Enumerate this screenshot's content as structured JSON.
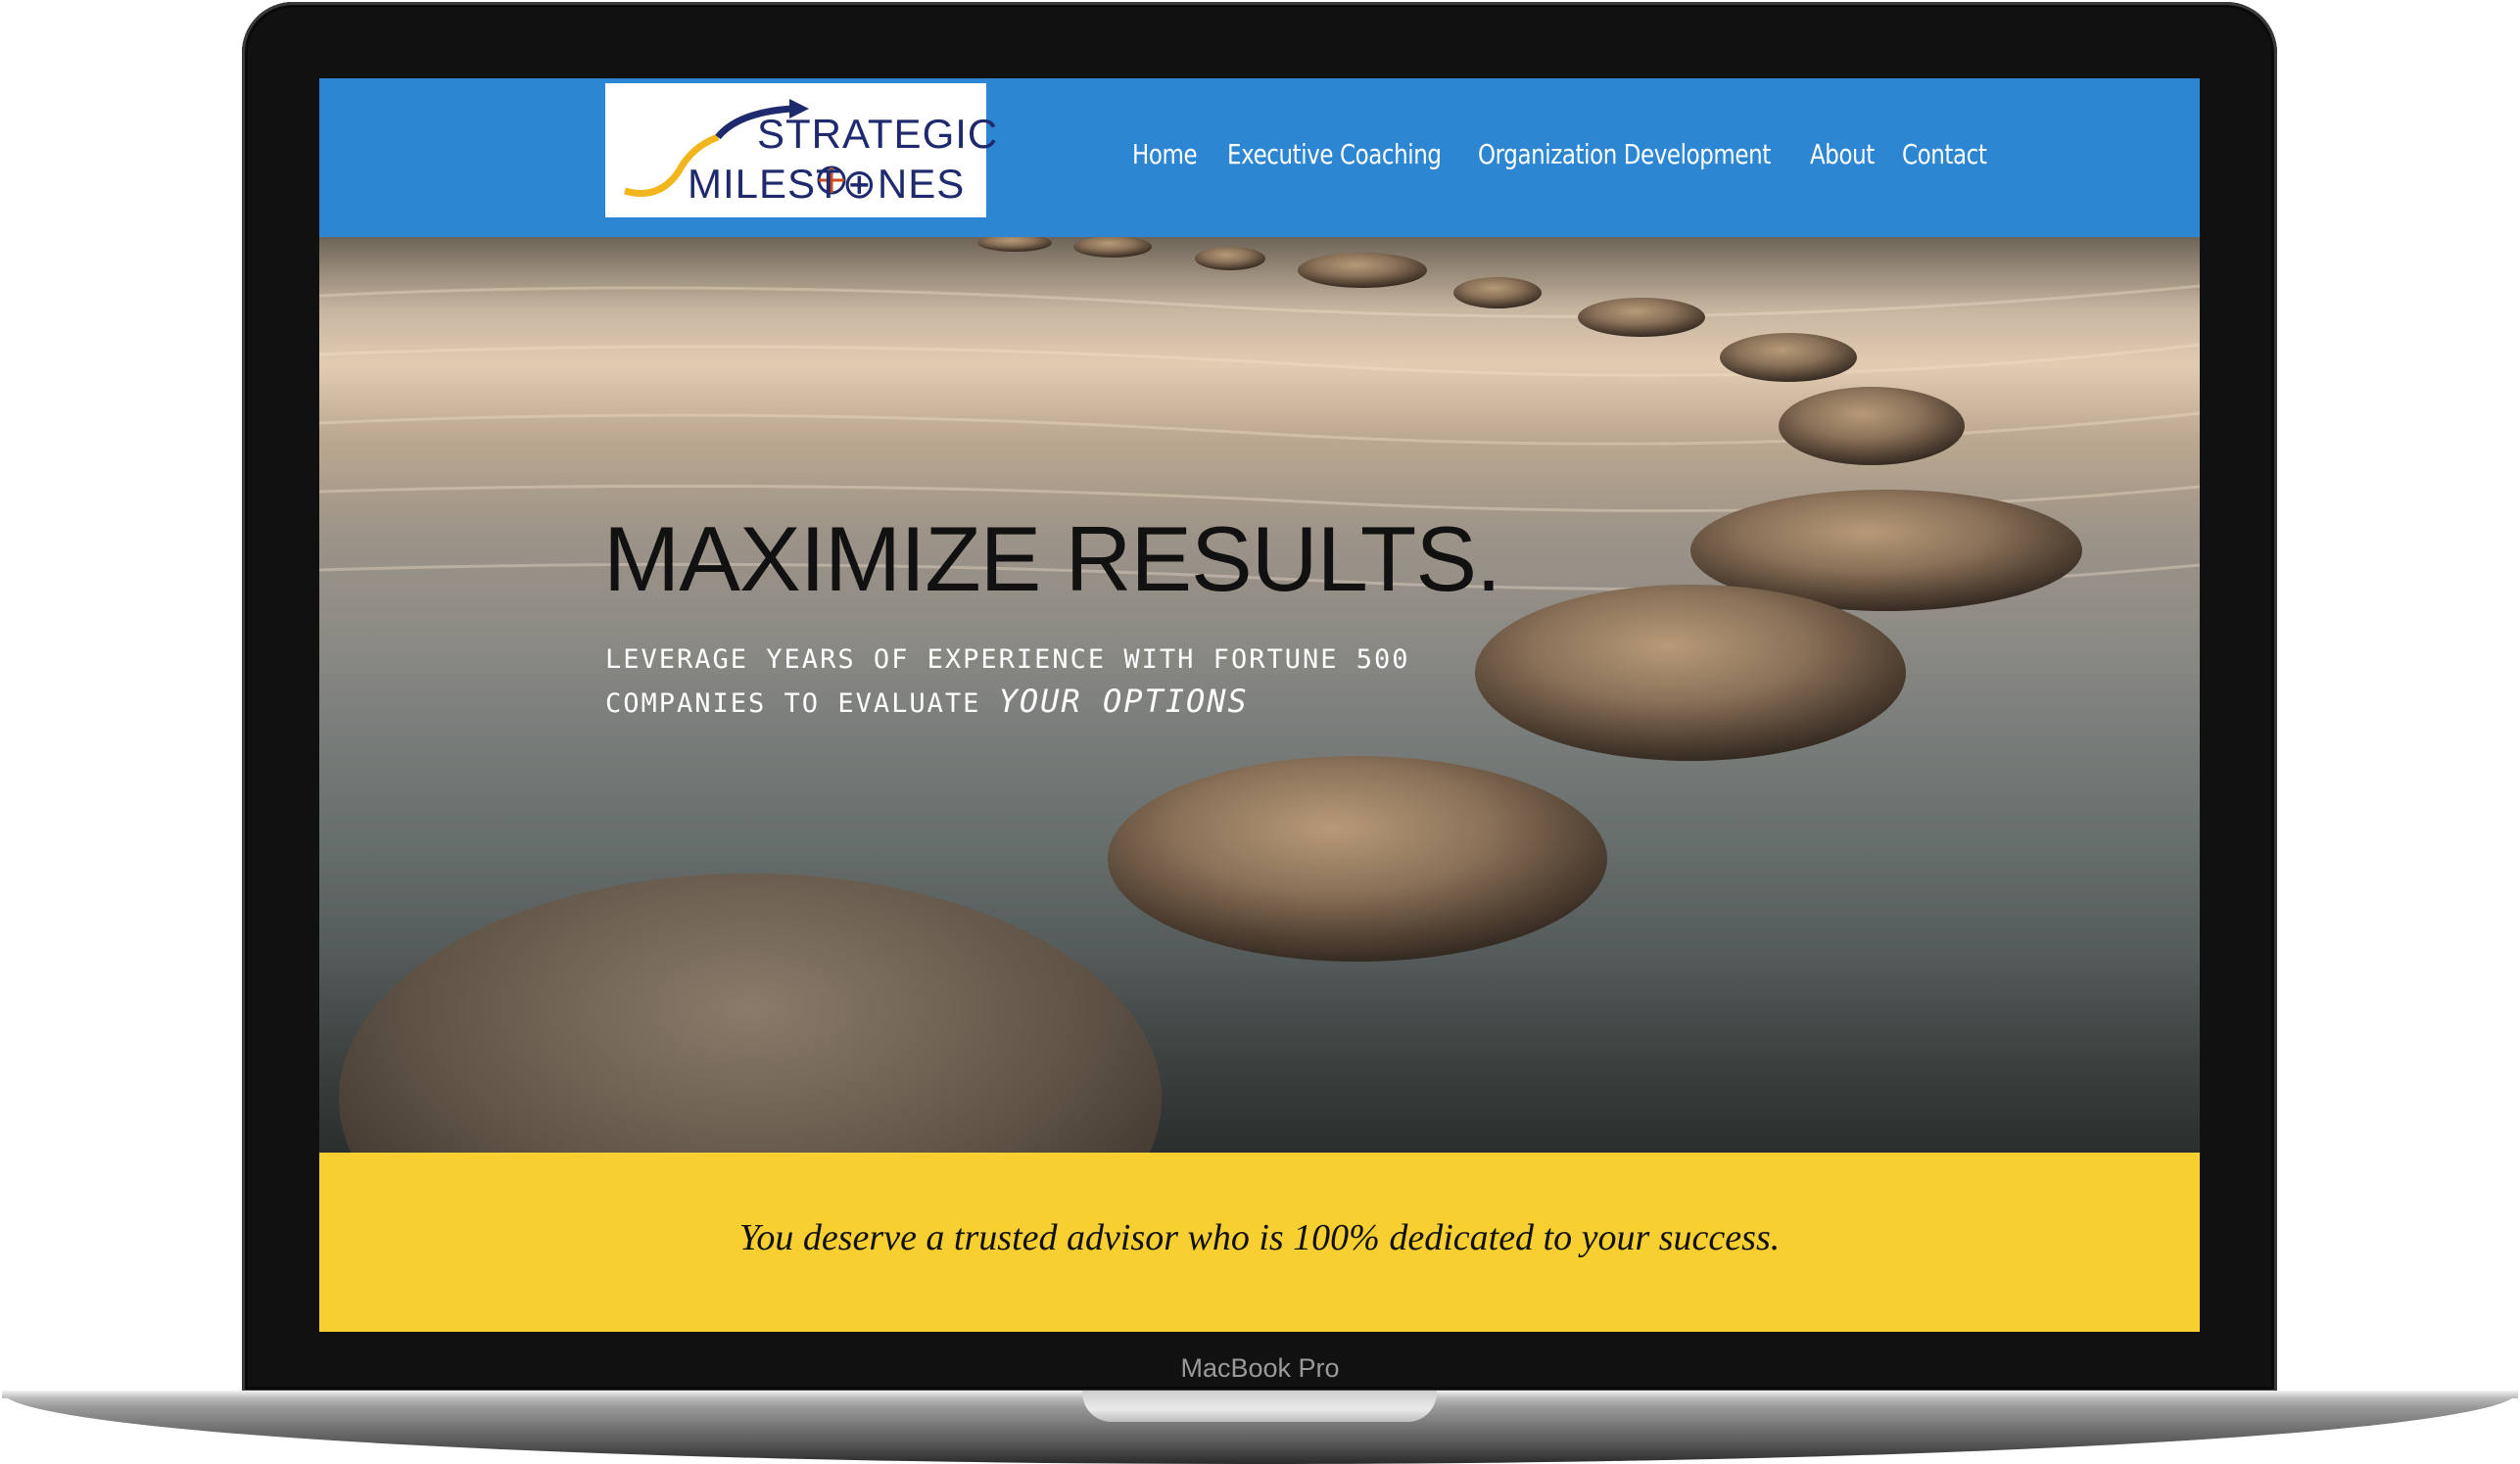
{
  "device": {
    "label": "MacBook Pro"
  },
  "header": {
    "logo": {
      "line1": "STRATEGIC",
      "line2": "MILEST⊕NES"
    },
    "nav": [
      {
        "label": "Home"
      },
      {
        "label": "Executive Coaching"
      },
      {
        "label": "Organization Development"
      },
      {
        "label": "About"
      },
      {
        "label": "Contact"
      }
    ],
    "background_color": "#2d86d1"
  },
  "hero": {
    "title": "MAXIMIZE RESULTS.",
    "subtitle_line1": "LEVERAGE YEARS OF EXPERIENCE WITH FORTUNE 500",
    "subtitle_line2_prefix": "COMPANIES TO EVALUATE ",
    "subtitle_line2_emphasis": "YOUR OPTIONS"
  },
  "banner": {
    "text": "You deserve a trusted advisor who is 100% dedicated to your success.",
    "background_color": "#f8cf31"
  }
}
